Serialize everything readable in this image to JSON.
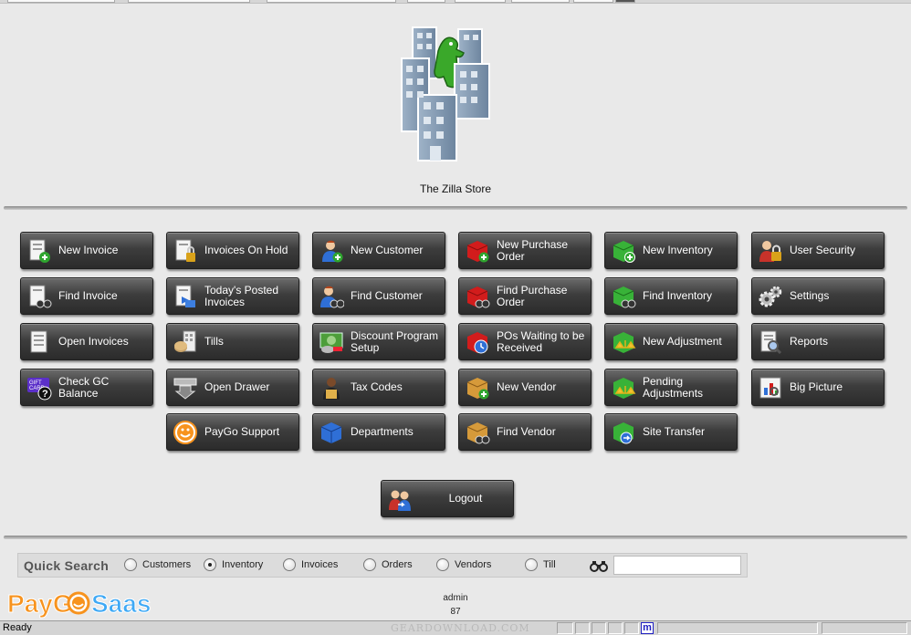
{
  "store": {
    "name": "The Zilla Store"
  },
  "buttons": {
    "new_invoice": "New Invoice",
    "invoices_on_hold": "Invoices On Hold",
    "new_customer": "New Customer",
    "new_purchase_order": "New Purchase Order",
    "new_inventory": "New Inventory",
    "user_security": "User Security",
    "find_invoice": "Find Invoice",
    "todays_posted_invoices": "Today's Posted Invoices",
    "find_customer": "Find Customer",
    "find_purchase_order": "Find Purchase Order",
    "find_inventory": "Find Inventory",
    "settings": "Settings",
    "open_invoices": "Open Invoices",
    "tills": "Tills",
    "discount_program_setup": "Discount Program Setup",
    "pos_waiting": "POs Waiting to be Received",
    "new_adjustment": "New Adjustment",
    "reports": "Reports",
    "check_gc_balance": "Check GC Balance",
    "open_drawer": "Open Drawer",
    "tax_codes": "Tax Codes",
    "new_vendor": "New Vendor",
    "pending_adjustments": "Pending Adjustments",
    "big_picture": "Big Picture",
    "paygo_support": "PayGo Support",
    "departments": "Departments",
    "find_vendor": "Find Vendor",
    "site_transfer": "Site Transfer",
    "logout": "Logout"
  },
  "quick_search": {
    "title": "Quick Search",
    "options": [
      "Customers",
      "Inventory",
      "Invoices",
      "Orders",
      "Vendors",
      "Till"
    ],
    "selected": "Inventory",
    "value": ""
  },
  "footer": {
    "brand_left": "PayG",
    "brand_right": "Saas",
    "user": "admin",
    "number": "87"
  },
  "status": {
    "text": "Ready",
    "watermark": "GEARDOWNLOAD.COM",
    "badge": "m"
  },
  "colors": {
    "tile_top": "#6b6b6b",
    "tile_bottom": "#2b2b2b",
    "brand_orange": "#f7931e",
    "brand_blue": "#3fa9f5"
  }
}
